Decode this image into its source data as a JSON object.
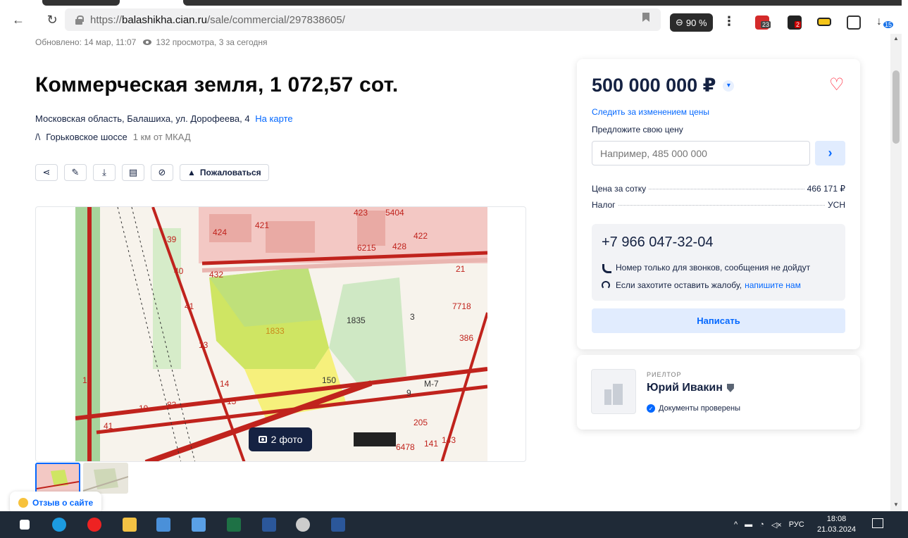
{
  "browser": {
    "url_proto": "https://",
    "url_host": "balashikha.cian.ru",
    "url_path": "/sale/commercial/297838605/",
    "zoom": "90 %",
    "ext_badge_1": "23",
    "ext_badge_2": "2",
    "download_badge": "15"
  },
  "meta": {
    "updated": "Обновлено: 14 мар, 11:07",
    "views": "132 просмотра, 3 за сегодня"
  },
  "listing": {
    "title": "Коммерческая земля, 1 072,57 сот.",
    "address": "Московская область, Балашиха, ул. Дорофеева, 4",
    "map_link": "На карте",
    "highway": "Горьковское шоссе",
    "distance": "1 км от МКАД",
    "complain_label": "Пожаловаться"
  },
  "gallery": {
    "photo_count": "2 фото",
    "map_labels": {
      "l423": "423",
      "l5404": "5404",
      "l424": "424",
      "l421": "421",
      "l428": "428",
      "l422": "422",
      "l6215": "6215",
      "l39": "39",
      "l40": "40",
      "l432": "432",
      "l21": "21",
      "l7718": "7718",
      "l1833": "1833",
      "l1835": "1835",
      "l3": "3",
      "l386": "386",
      "l41": "41",
      "l13": "13",
      "l14": "14",
      "l15": "15",
      "l150": "150",
      "l9": "9",
      "lm7": "M-7",
      "l205": "205",
      "l141": "141",
      "l143": "143",
      "l6478": "6478",
      "l19": "19",
      "l83": "83",
      "l10": "10",
      "l41b": "41"
    }
  },
  "feedback": {
    "label": "Отзыв о сайте"
  },
  "price_card": {
    "price": "500 000 000 ₽",
    "follow": "Следить за изменением цены",
    "offer_label": "Предложите свою цену",
    "offer_placeholder": "Например, 485 000 000",
    "per_sotka_label": "Цена за сотку",
    "per_sotka_value": "466 171 ₽",
    "tax_label": "Налог",
    "tax_value": "УСН",
    "phone": "+7 966 047-32-04",
    "note_calls": "Номер только для звонков, сообщения не дойдут",
    "note_complaint": "Если захотите оставить жалобу,",
    "note_complaint_link": "напишите нам",
    "write_button": "Написать"
  },
  "agent_card": {
    "role": "РИЕЛТОР",
    "name": "Юрий Ивакин",
    "verified": "Документы проверены"
  },
  "taskbar": {
    "lang": "РУС",
    "time": "18:08",
    "date": "21.03.2024"
  },
  "colors": {
    "accent": "#0468ff",
    "heart": "#ff1f34",
    "text": "#152242",
    "taskbar": "#1f2a37"
  }
}
